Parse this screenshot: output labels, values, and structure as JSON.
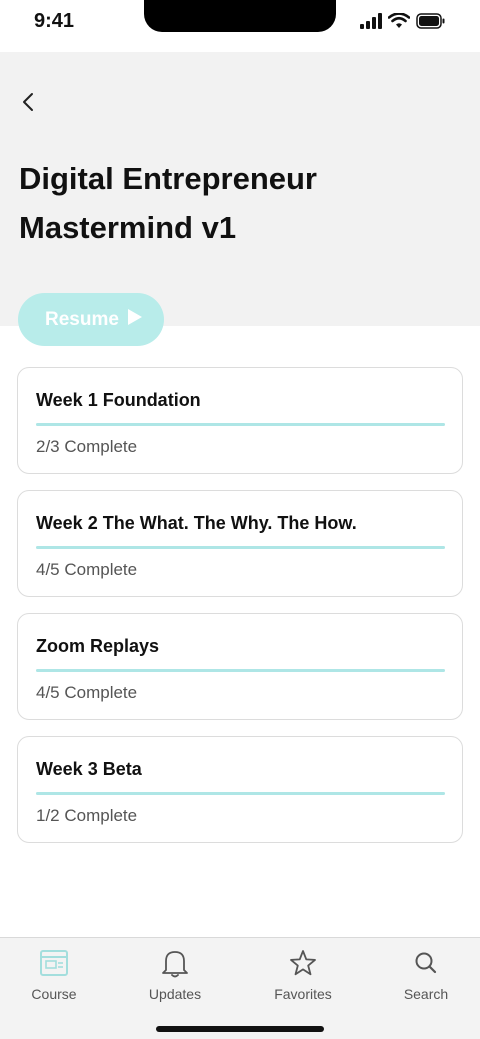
{
  "status": {
    "time": "9:41"
  },
  "header": {
    "title_line1": "Digital Entrepreneur",
    "title_line2": "Mastermind v1",
    "back_icon": "chevron-left-icon"
  },
  "resume": {
    "label": "Resume",
    "icon": "play-icon"
  },
  "modules": [
    {
      "title": "Week 1 Foundation",
      "progress_text": "2/3 Complete",
      "progress": 1.0
    },
    {
      "title": "Week 2 The What. The Why. The How.",
      "progress_text": "4/5 Complete",
      "progress": 1.0
    },
    {
      "title": "Zoom Replays",
      "progress_text": "4/5 Complete",
      "progress": 1.0
    },
    {
      "title": "Week 3 Beta",
      "progress_text": "1/2 Complete",
      "progress": 1.0
    }
  ],
  "tabs": [
    {
      "label": "Course",
      "icon": "course-icon",
      "active": true
    },
    {
      "label": "Updates",
      "icon": "bell-icon",
      "active": false
    },
    {
      "label": "Favorites",
      "icon": "star-icon",
      "active": false
    },
    {
      "label": "Search",
      "icon": "search-icon",
      "active": false
    }
  ],
  "colors": {
    "accent": "#b8ecea",
    "progress": "#aee6e6",
    "header_bg": "#f2f2f2"
  }
}
